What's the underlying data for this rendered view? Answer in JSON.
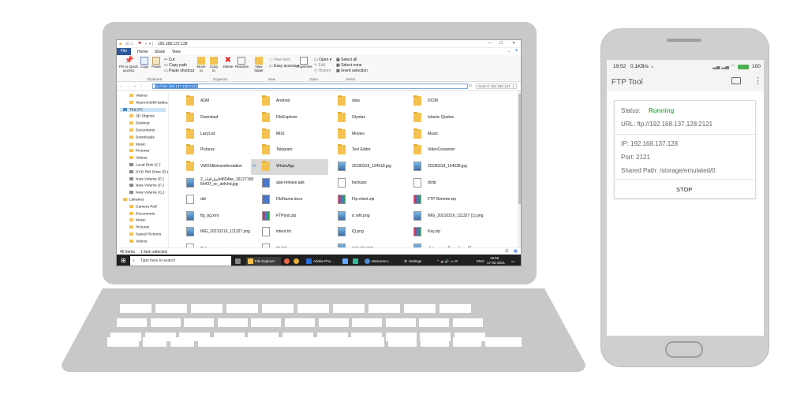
{
  "explorer": {
    "title_path": "192.168.137.128",
    "tabs": [
      "File",
      "Home",
      "Share",
      "View"
    ],
    "ribbon": {
      "clipboard": {
        "pin": "Pin to Quick access",
        "copy": "Copy",
        "paste": "Paste",
        "cut": "Cut",
        "copy_path": "Copy path",
        "paste_shortcut": "Paste shortcut",
        "group": "Clipboard"
      },
      "organize": {
        "move": "Move to",
        "copyto": "Copy to",
        "delete": "Delete",
        "rename": "Rename",
        "group": "Organize"
      },
      "new": {
        "new_folder": "New folder",
        "new_item": "New item",
        "easy_access": "Easy access",
        "group": "New"
      },
      "open": {
        "properties": "Properties",
        "open": "Open",
        "edit": "Edit",
        "history": "History",
        "group": "Open"
      },
      "select": {
        "select_all": "Select all",
        "select_none": "Select none",
        "invert": "Invert selection",
        "group": "Select"
      }
    },
    "address": "ftp://192.168.137.128:2121/",
    "search_placeholder": "Search 192.168.137....",
    "nav_items": [
      "Videos",
      "XiaomiADBFastboo",
      "This PC",
      "3D Objects",
      "Desktop",
      "Documents",
      "Downloads",
      "Music",
      "Pictures",
      "Videos",
      "Local Disk (C:)",
      "DVD RW Drive (D:)",
      "New Volume (E:)",
      "New Volume (F:)",
      "New Volume (G:)",
      "Libraries",
      "Camera Roll",
      "Documents",
      "Music",
      "Pictures",
      "Saved Pictures",
      "Videos"
    ],
    "files": [
      {
        "name": "ADM",
        "icon": "folder"
      },
      {
        "name": "Android",
        "icon": "folder"
      },
      {
        "name": "data",
        "icon": "folder"
      },
      {
        "name": "DCIM",
        "icon": "folder"
      },
      {
        "name": "Download",
        "icon": "folder"
      },
      {
        "name": "FileExplorer",
        "icon": "folder"
      },
      {
        "name": "Glyntax",
        "icon": "folder"
      },
      {
        "name": "Islamic Quotes",
        "icon": "folder"
      },
      {
        "name": "LazyList",
        "icon": "folder"
      },
      {
        "name": "MIUI",
        "icon": "folder"
      },
      {
        "name": "Movies",
        "icon": "folder"
      },
      {
        "name": "Music",
        "icon": "folder"
      },
      {
        "name": "Pictures",
        "icon": "folder"
      },
      {
        "name": "Telegram",
        "icon": "folder"
      },
      {
        "name": "Text Editor",
        "icon": "folder"
      },
      {
        "name": "VideoConverter",
        "icon": "folder"
      },
      {
        "name": "VMOSfiletransferstation",
        "icon": "folder"
      },
      {
        "name": "WhatsApp",
        "icon": "folder"
      },
      {
        "name": "20180318_134518.jpg",
        "icon": "image"
      },
      {
        "name": "20180318_134638.jpg",
        "icon": "image"
      },
      {
        "name": "ﻣﻴﻞﺍﻗﻴﺎﺩ_2b4654be_16127158 64437_sc_ahfchd.jpg",
        "icon": "image"
      },
      {
        "name": "app-release.apk",
        "icon": "apk"
      },
      {
        "name": "backups",
        "icon": "file"
      },
      {
        "name": "dcttp",
        "icon": "file"
      },
      {
        "name": "did",
        "icon": "file"
      },
      {
        "name": "FileName.docx",
        "icon": "doc"
      },
      {
        "name": "Ftp-client.zip",
        "icon": "zip"
      },
      {
        "name": "FTP Remote.zip",
        "icon": "zip"
      },
      {
        "name": "ftp_bg.xml",
        "icon": "xml"
      },
      {
        "name": "FTPtool.zip",
        "icon": "zip"
      },
      {
        "name": "ic wht.png",
        "icon": "image"
      },
      {
        "name": "IMG_20210216_111327 (1).png",
        "icon": "image"
      },
      {
        "name": "IMG_20210216_111327.png",
        "icon": "image"
      },
      {
        "name": "intent.txt",
        "icon": "file"
      },
      {
        "name": "iQ.png",
        "icon": "image"
      },
      {
        "name": "Key.zip",
        "icon": "zip"
      },
      {
        "name": "m.s",
        "icon": "file"
      },
      {
        "name": "my.txt",
        "icon": "file"
      },
      {
        "name": "new pic.png",
        "icon": "image"
      },
      {
        "name": "ﺍﻟﻠﻪ ﺑﯿﻤﺎﺭﯼ ﺧﺎﻟﻖ ﮨﯿﮟ ﺑﯿﺸﮏ",
        "icon": "image"
      }
    ],
    "status_count": "40 items",
    "status_selected": "1 item selected",
    "taskbar": {
      "search": "Type here to search",
      "apps": [
        "File Explorer",
        "Adobe Pho...",
        "Welcome t...",
        "Settings"
      ],
      "lang": "ENG",
      "time": "19:55",
      "date": "17-02-2021"
    }
  },
  "phone": {
    "status_time": "19:52",
    "status_speed": "0.1KB/s",
    "battery": "100",
    "app_title": "FTP Tool",
    "status_label": "Status:",
    "status_value": "Running",
    "url": "URL: ftp://192.168.137.128:2121",
    "ip": "IP: 192.168.137.128",
    "port": "Port: 2121",
    "shared_path": "Shared Path: /storage/emulated/0",
    "stop_label": "STOP",
    "accent_color": "#4caf50"
  }
}
